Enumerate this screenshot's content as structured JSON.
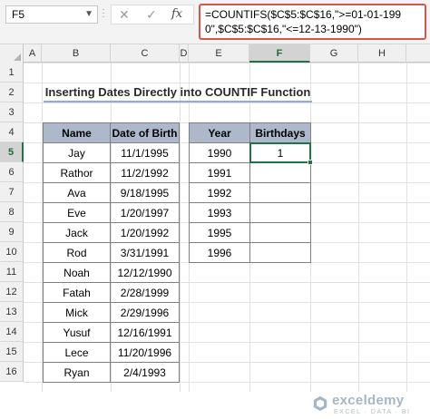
{
  "formula_bar": {
    "name_box": "F5",
    "cancel_glyph": "✕",
    "enter_glyph": "✓",
    "fx_label": "fx",
    "formula": "=COUNTIFS($C$5:$C$16,\">=01-01-1990\",$C$5:$C$16,\"<=12-13-1990\")"
  },
  "columns": [
    "A",
    "B",
    "C",
    "D",
    "E",
    "F",
    "G",
    "H"
  ],
  "rows": [
    "1",
    "2",
    "3",
    "4",
    "5",
    "6",
    "7",
    "8",
    "9",
    "10",
    "11",
    "12",
    "13",
    "14",
    "15",
    "16"
  ],
  "title": "Inserting Dates Directly into COUNTIF Function",
  "birth_table": {
    "headers": [
      "Name",
      "Date of Birth"
    ],
    "rows": [
      [
        "Jay",
        "11/1/1995"
      ],
      [
        "Rathor",
        "11/2/1992"
      ],
      [
        "Ava",
        "9/18/1995"
      ],
      [
        "Eve",
        "1/20/1997"
      ],
      [
        "Jack",
        "1/20/1992"
      ],
      [
        "Rod",
        "3/31/1991"
      ],
      [
        "Noah",
        "12/12/1990"
      ],
      [
        "Fatah",
        "2/28/1999"
      ],
      [
        "Mick",
        "2/29/1996"
      ],
      [
        "Yusuf",
        "12/16/1991"
      ],
      [
        "Lece",
        "11/20/1996"
      ],
      [
        "Ryan",
        "2/4/1993"
      ]
    ]
  },
  "year_table": {
    "headers": [
      "Year",
      "Birthdays"
    ],
    "rows": [
      [
        "1990",
        "1"
      ],
      [
        "1991",
        ""
      ],
      [
        "1992",
        ""
      ],
      [
        "1993",
        ""
      ],
      [
        "1995",
        ""
      ],
      [
        "1996",
        ""
      ]
    ]
  },
  "watermark": {
    "name": "exceldemy",
    "tagline": "EXCEL · DATA · BI"
  },
  "colors": {
    "header_fill": "#adb9ca",
    "selection_green": "#217346",
    "formula_border": "#d9534f",
    "title_underline": "#8faadc"
  }
}
